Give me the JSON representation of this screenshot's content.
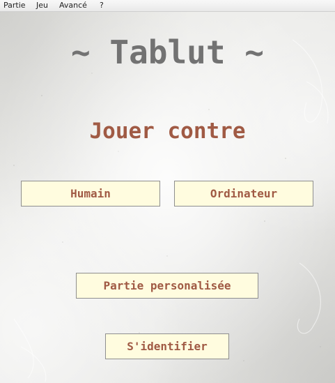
{
  "menu": {
    "items": [
      "Partie",
      "Jeu",
      "Avancé",
      "?"
    ]
  },
  "main": {
    "title": "~ Tablut ~",
    "subtitle": "Jouer contre",
    "buttons": {
      "humain": "Humain",
      "ordinateur": "Ordinateur",
      "partie_personalisee": "Partie personalisée",
      "identifier": "S'identifier"
    }
  },
  "colors": {
    "title": "#727272",
    "accent": "#a05a44",
    "button_background": "#fffcdf",
    "button_border": "#8e8e8e"
  }
}
